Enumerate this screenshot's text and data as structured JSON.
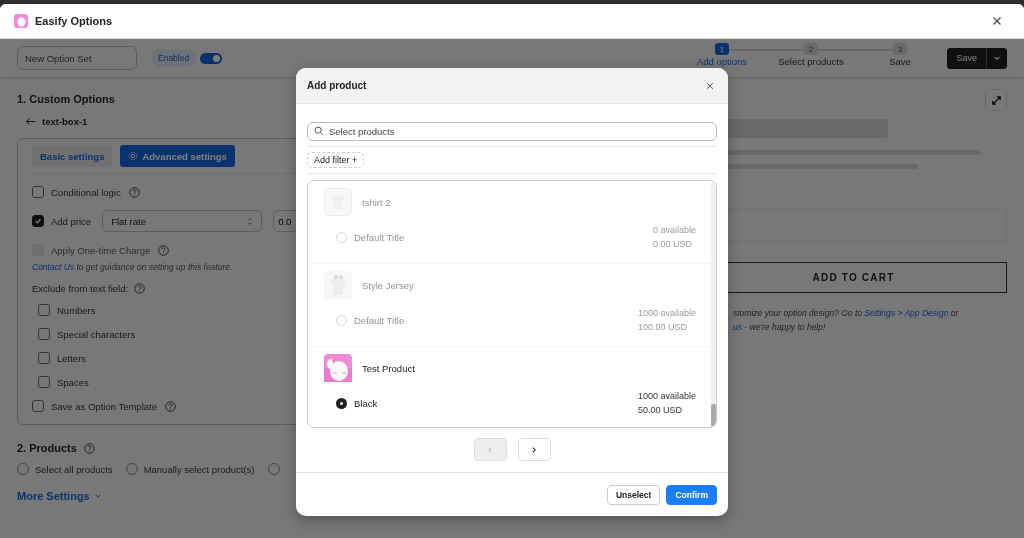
{
  "window": {
    "title": "Easify Options"
  },
  "header": {
    "name_field": {
      "value": "New Option Set"
    },
    "status_badge": "Enabled",
    "enabled": true,
    "steps": [
      {
        "number": "1",
        "label": "Add options",
        "selected": true
      },
      {
        "number": "2",
        "label": "Select products",
        "selected": false
      },
      {
        "number": "3",
        "label": "Save",
        "selected": false
      }
    ],
    "save_button": "Save"
  },
  "custom_options": {
    "heading": "1. Custom Options",
    "back_label": "text-box-1",
    "tabs": [
      {
        "label": "Basic settings",
        "selected": false
      },
      {
        "label": "Advanced settings",
        "selected": true
      }
    ],
    "conditional_logic": {
      "label": "Conditional logic",
      "checked": false
    },
    "add_price": {
      "label": "Add price",
      "checked": true,
      "type_select": {
        "value": "Flat rate"
      },
      "amount_field": {
        "value": "0.0"
      }
    },
    "one_time_charge": {
      "label": "Apply One-time Charge",
      "checked": false,
      "disabled": true
    },
    "guidance": {
      "link": "Contact Us",
      "text": " to get guidance on setting up this feature."
    },
    "exclude": {
      "label": "Exclude from text field:",
      "options": [
        {
          "label": "Numbers",
          "checked": false
        },
        {
          "label": "Special characters",
          "checked": false
        },
        {
          "label": "Letters",
          "checked": false
        },
        {
          "label": "Spaces",
          "checked": false
        }
      ]
    },
    "save_template": {
      "label": "Save as Option Template",
      "checked": false
    }
  },
  "products_section": {
    "heading": "2. Products",
    "options": [
      {
        "label": "Select all products",
        "selected": false
      },
      {
        "label": "Manually select product(s)",
        "selected": false
      },
      {
        "selected": false
      }
    ],
    "more_settings": "More Settings"
  },
  "preview": {
    "add_to_cart": "ADD TO CART",
    "note": [
      [
        {
          "kind": "text",
          "text": "stomize your option design? Go to "
        },
        {
          "kind": "link",
          "text": "Settings > App Design"
        },
        {
          "kind": "text",
          "text": " or"
        }
      ],
      [
        {
          "kind": "link",
          "text": "us"
        },
        {
          "kind": "text",
          "text": " - we're happy to help!"
        }
      ]
    ]
  },
  "modal": {
    "title": "Add product",
    "search": {
      "placeholder": "Select products"
    },
    "add_filter": "Add filter +",
    "products": [
      {
        "name": "tshirt 2",
        "dimmed": true,
        "image": {
          "kind": "picture"
        },
        "variants": [
          {
            "name": "Default Title",
            "selected": false,
            "stock": "0 available",
            "price": "0.00 USD"
          }
        ]
      },
      {
        "name": "Style Jersey",
        "dimmed": true,
        "image": {
          "kind": "picture"
        },
        "variants": [
          {
            "name": "Default Title",
            "selected": false,
            "stock": "1000 available",
            "price": "100.00 USD"
          }
        ]
      },
      {
        "name": "Test Product",
        "dimmed": false,
        "image": {
          "kind": "picture"
        },
        "variants": [
          {
            "name": "Black",
            "selected": true,
            "stock": "1000 available",
            "price": "50.00 USD"
          }
        ]
      }
    ],
    "pagination": {
      "previous_disabled": true,
      "next_disabled": false
    },
    "buttons": [
      {
        "label": "Unselect",
        "kind": "secondary"
      },
      {
        "label": "Confirm",
        "kind": "primary"
      }
    ]
  }
}
